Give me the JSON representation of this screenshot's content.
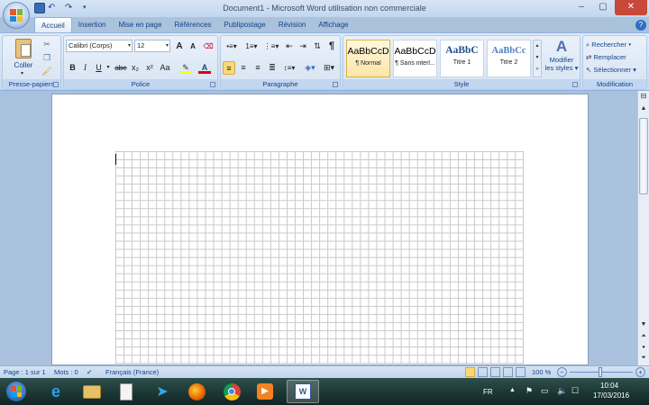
{
  "window": {
    "title": "Document1 - Microsoft Word utilisation non commerciale",
    "minimize": "–",
    "maximize": "▢",
    "close": "✕"
  },
  "tabs": [
    "Accueil",
    "Insertion",
    "Mise en page",
    "Références",
    "Publipostage",
    "Révision",
    "Affichage"
  ],
  "ribbon": {
    "clipboard": {
      "label": "Presse-papiers",
      "paste": "Coller"
    },
    "font": {
      "label": "Police",
      "font_name": "Calibri (Corps)",
      "font_size": "12",
      "bold": "B",
      "italic": "I",
      "underline": "U",
      "strike": "abe",
      "subscript": "x₂",
      "superscript": "x²",
      "change_case": "Aa",
      "grow": "A",
      "shrink": "A"
    },
    "paragraph": {
      "label": "Paragraphe",
      "show_marks": "¶"
    },
    "styles": {
      "label": "Style",
      "items": [
        {
          "sample": "AaBbCcD",
          "name": "¶ Normal"
        },
        {
          "sample": "AaBbCcD",
          "name": "¶ Sans interl..."
        },
        {
          "sample": "AaBbC",
          "name": "Titre 1"
        },
        {
          "sample": "AaBbCc",
          "name": "Titre 2"
        }
      ],
      "change_styles_line1": "Modifier",
      "change_styles_line2": "les styles"
    },
    "editing": {
      "label": "Modification",
      "find": "Rechercher",
      "replace": "Remplacer",
      "select": "Sélectionner"
    }
  },
  "status": {
    "page": "Page : 1 sur 1",
    "words": "Mots : 0",
    "language": "Français (France)",
    "zoom": "100 %"
  },
  "taskbar": {
    "language": "FR",
    "time": "10:04",
    "date": "17/03/2016"
  },
  "colors": {
    "accent": "#15428b",
    "ribbon_bg": "#dfeaf7",
    "highlight_yellow": "#ffff00",
    "font_red": "#e00000",
    "close_red": "#c8483a"
  }
}
